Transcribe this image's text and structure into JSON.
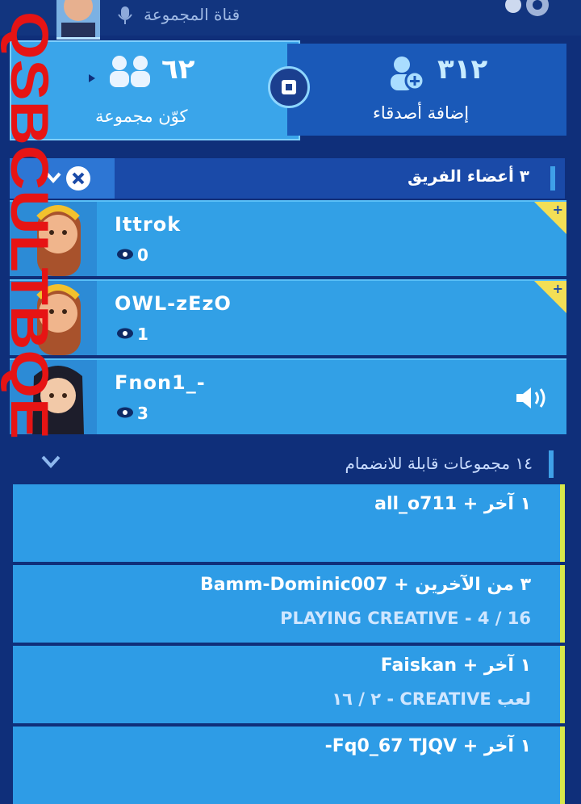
{
  "channel": {
    "label": "قناة المجموعة"
  },
  "party_button": {
    "count": "٦٢",
    "label": "كوّن مجموعة"
  },
  "friends_button": {
    "count": "٣١٢",
    "label": "إضافة أصدقاء"
  },
  "team": {
    "title": "٣ أعضاء الفريق",
    "members": [
      {
        "name": "Ittrok",
        "level": "0"
      },
      {
        "name": "OWL-zEzO",
        "level": "1"
      },
      {
        "name": "Fnon1_-",
        "level": "3"
      }
    ]
  },
  "joinable": {
    "title": "١٤ مجموعات قابلة للانضمام"
  },
  "parties": [
    {
      "line1": "١ آخر + all_o711",
      "line2": ""
    },
    {
      "line1": "٣ من الآخرين + Bamm-Dominic007",
      "line2": "PLAYING CREATIVE - 4 / 16"
    },
    {
      "line1": "١ آخر + Faiskan",
      "line2": "لعب CREATIVE - ٢ / ١٦"
    },
    {
      "line1": "١ آخر + Fq0_67 TJQV-",
      "line2": ""
    }
  ],
  "watermark_text": "QSBCULTBQE",
  "colors": {
    "accent_yellow": "#f3df56",
    "panel_blue": "#32a0e6",
    "dark_blue": "#0f2f7a",
    "watermark_red": "#e61414"
  }
}
